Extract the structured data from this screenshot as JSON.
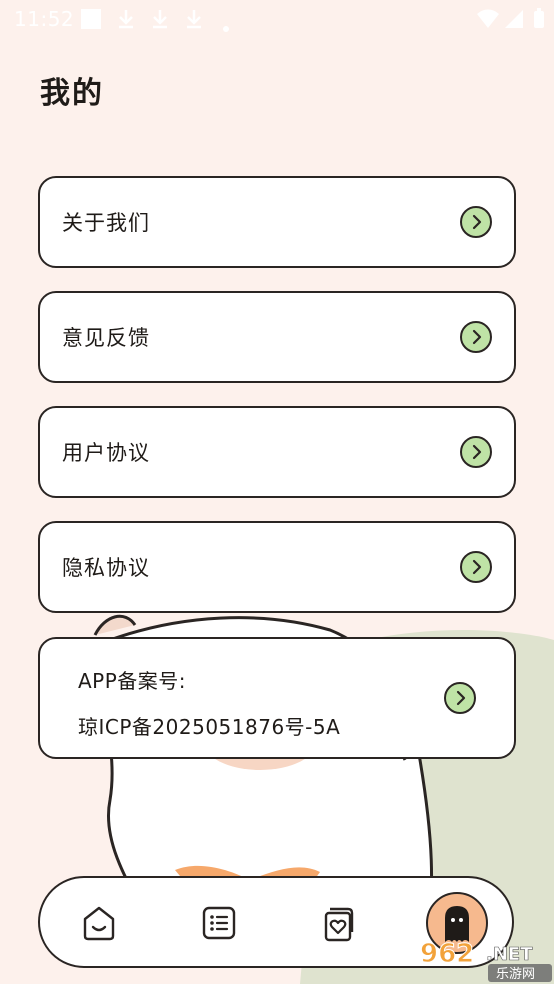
{
  "status_bar": {
    "time": "11:52"
  },
  "page": {
    "title": "我的"
  },
  "menu": [
    {
      "label": "关于我们"
    },
    {
      "label": "意见反馈"
    },
    {
      "label": "用户协议"
    },
    {
      "label": "隐私协议"
    }
  ],
  "icp": {
    "heading": "APP备案号:",
    "number": "琼ICP备2025051876号-5A"
  },
  "bottom_nav": [
    {
      "icon": "home-icon"
    },
    {
      "icon": "list-icon"
    },
    {
      "icon": "heart-card-icon"
    },
    {
      "icon": "ghost-avatar-icon",
      "active": true
    }
  ],
  "watermark": {
    "text_top": "962",
    "text_net": ".NET",
    "text_bottom": "乐游网"
  },
  "colors": {
    "background": "#fdf1ec",
    "accent_green": "#bfe3a6",
    "avatar_orange": "#f6b98e",
    "outline": "#2a2523"
  }
}
